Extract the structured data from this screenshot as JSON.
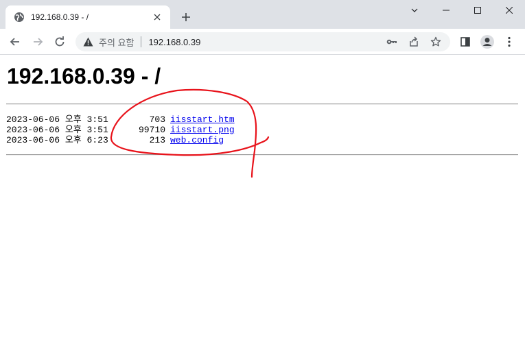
{
  "browser": {
    "tab": {
      "title": "192.168.0.39 - /"
    },
    "omnibox": {
      "security_label": "주의 요함",
      "url": "192.168.0.39"
    }
  },
  "page": {
    "heading": "192.168.0.39 - /",
    "files": [
      {
        "date": "2023-06-06 오후 3:51",
        "size": "703",
        "name": "iisstart.htm"
      },
      {
        "date": "2023-06-06 오후 3:51",
        "size": "99710",
        "name": "iisstart.png"
      },
      {
        "date": "2023-06-06 오후 6:23",
        "size": "213",
        "name": "web.config"
      }
    ]
  },
  "colors": {
    "annotation": "#e8131b",
    "link": "#0000ee",
    "chrome": "#dee1e6"
  }
}
